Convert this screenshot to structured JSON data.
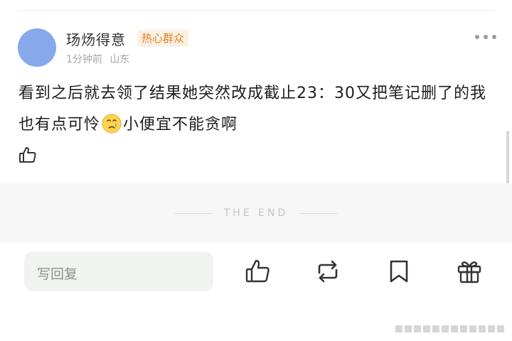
{
  "post": {
    "username": "玚炀得意",
    "badge": "热心群众",
    "time": "1分钟前",
    "location": "山东",
    "text_before_emoji": "看到之后就去领了结果她突然改成截止23：30又把笔记删了的我也有点可怜",
    "emoji": "crying-face-emoji",
    "text_after_emoji": "小便宜不能贪啊"
  },
  "divider": {
    "text": "THE END"
  },
  "bottom_bar": {
    "reply_placeholder": "写回复"
  },
  "icons": [
    "more-icon",
    "like-icon",
    "repost-icon",
    "bookmark-icon",
    "gift-icon"
  ],
  "colors": {
    "badge_text": "#e2802a",
    "badge_bg": "#fdf1e4",
    "avatar": "#88a8ec"
  }
}
